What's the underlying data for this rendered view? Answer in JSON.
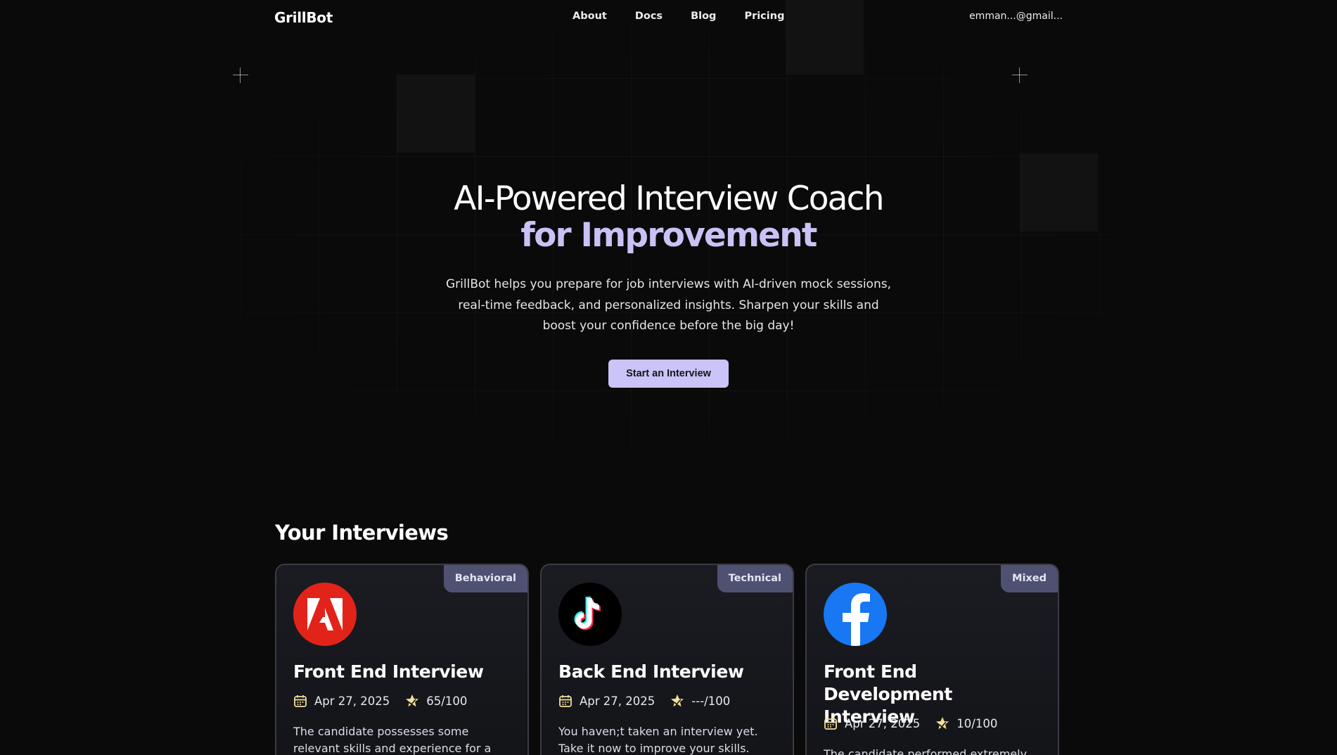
{
  "nav": {
    "logo": "GrillBot",
    "links": [
      "About",
      "Docs",
      "Blog",
      "Pricing"
    ],
    "user_email": "emman...@gmail..."
  },
  "hero": {
    "title_line1": "AI-Powered Interview Coach",
    "title_line2": "for Improvement",
    "subtitle": "GrillBot helps you prepare for job interviews with AI-driven mock sessions, real-time feedback, and personalized insights. Sharpen your skills and boost your confidence before the big day!",
    "cta_label": "Start an Interview"
  },
  "interviews": {
    "heading": "Your Interviews",
    "cards": [
      {
        "badge": "Behavioral",
        "logo": "adobe-logo",
        "title": "Front End Interview",
        "date": "Apr 27, 2025",
        "score": "65/100",
        "description": "The candidate possesses some relevant skills and experience for a front-end..."
      },
      {
        "badge": "Technical",
        "logo": "tiktok-logo",
        "title": "Back End Interview",
        "date": "Apr 27, 2025",
        "score": "---/100",
        "description": "You haven;t taken an interview yet. Take it now to improve your skills."
      },
      {
        "badge": "Mixed",
        "logo": "facebook-logo",
        "title": "Front End Development Interview",
        "date": "Apr 27, 2025",
        "score": "10/100",
        "description": "The candidate performed extremely"
      }
    ]
  },
  "colors": {
    "background": "#0a0a0b",
    "accent": "#c9c2f5",
    "cta_bg": "#cac4f8",
    "badge_bg": "#4e5171",
    "star": "#f3df9a"
  }
}
